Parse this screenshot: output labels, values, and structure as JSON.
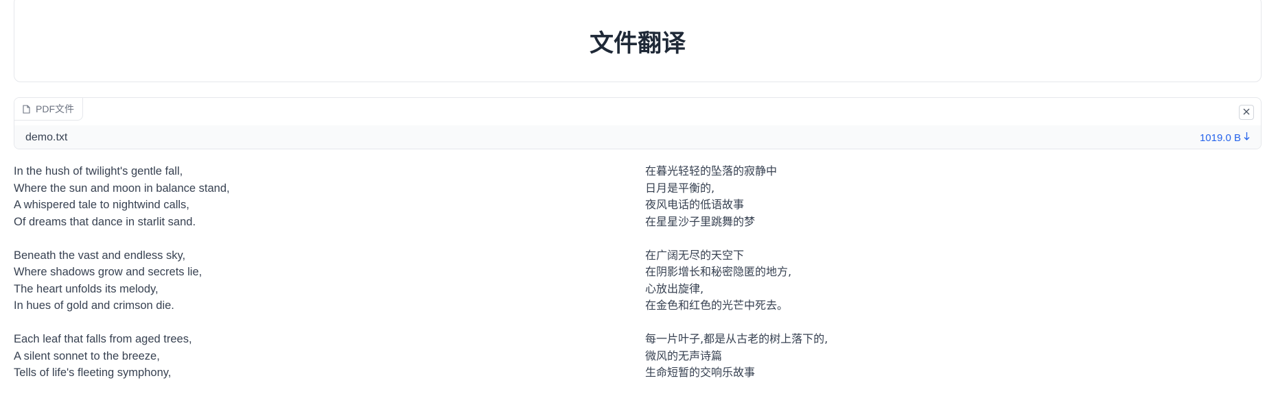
{
  "header": {
    "title": "文件翻译"
  },
  "file_panel": {
    "tab_label": "PDF文件",
    "file_name": "demo.txt",
    "file_size": "1019.0 B",
    "download_icon": "arrow-down-icon",
    "close_icon": "close-icon",
    "tab_icon": "file-icon"
  },
  "original": {
    "stanzas": [
      [
        "In the hush of twilight's gentle fall,",
        "Where the sun and moon in balance stand,",
        "A whispered tale to nightwind calls,",
        "Of dreams that dance in starlit sand."
      ],
      [
        "Beneath the vast and endless sky,",
        "Where shadows grow and secrets lie,",
        "The heart unfolds its melody,",
        "In hues of gold and crimson die."
      ],
      [
        "Each leaf that falls from aged trees,",
        "A silent sonnet to the breeze,",
        "Tells of life's fleeting symphony,"
      ]
    ]
  },
  "translation": {
    "stanzas": [
      [
        "在暮光轻轻的坠落的寂静中",
        "日月是平衡的,",
        "夜风电话的低语故事",
        "在星星沙子里跳舞的梦"
      ],
      [
        "在广阔无尽的天空下",
        "在阴影增长和秘密隐匿的地方,",
        "心放出旋律,",
        "在金色和红色的光芒中死去。"
      ],
      [
        "每一片叶子,都是从古老的树上落下的,",
        "微风的无声诗篇",
        "生命短暂的交响乐故事"
      ]
    ]
  }
}
